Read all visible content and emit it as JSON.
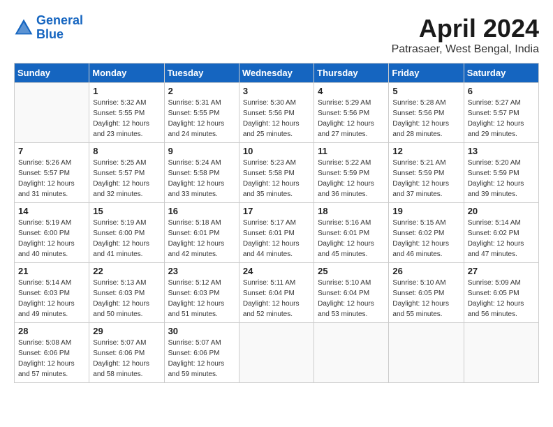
{
  "logo": {
    "line1": "General",
    "line2": "Blue"
  },
  "title": "April 2024",
  "subtitle": "Patrasaer, West Bengal, India",
  "headers": [
    "Sunday",
    "Monday",
    "Tuesday",
    "Wednesday",
    "Thursday",
    "Friday",
    "Saturday"
  ],
  "weeks": [
    [
      {
        "day": "",
        "sunrise": "",
        "sunset": "",
        "daylight": ""
      },
      {
        "day": "1",
        "sunrise": "Sunrise: 5:32 AM",
        "sunset": "Sunset: 5:55 PM",
        "daylight": "Daylight: 12 hours and 23 minutes."
      },
      {
        "day": "2",
        "sunrise": "Sunrise: 5:31 AM",
        "sunset": "Sunset: 5:55 PM",
        "daylight": "Daylight: 12 hours and 24 minutes."
      },
      {
        "day": "3",
        "sunrise": "Sunrise: 5:30 AM",
        "sunset": "Sunset: 5:56 PM",
        "daylight": "Daylight: 12 hours and 25 minutes."
      },
      {
        "day": "4",
        "sunrise": "Sunrise: 5:29 AM",
        "sunset": "Sunset: 5:56 PM",
        "daylight": "Daylight: 12 hours and 27 minutes."
      },
      {
        "day": "5",
        "sunrise": "Sunrise: 5:28 AM",
        "sunset": "Sunset: 5:56 PM",
        "daylight": "Daylight: 12 hours and 28 minutes."
      },
      {
        "day": "6",
        "sunrise": "Sunrise: 5:27 AM",
        "sunset": "Sunset: 5:57 PM",
        "daylight": "Daylight: 12 hours and 29 minutes."
      }
    ],
    [
      {
        "day": "7",
        "sunrise": "Sunrise: 5:26 AM",
        "sunset": "Sunset: 5:57 PM",
        "daylight": "Daylight: 12 hours and 31 minutes."
      },
      {
        "day": "8",
        "sunrise": "Sunrise: 5:25 AM",
        "sunset": "Sunset: 5:57 PM",
        "daylight": "Daylight: 12 hours and 32 minutes."
      },
      {
        "day": "9",
        "sunrise": "Sunrise: 5:24 AM",
        "sunset": "Sunset: 5:58 PM",
        "daylight": "Daylight: 12 hours and 33 minutes."
      },
      {
        "day": "10",
        "sunrise": "Sunrise: 5:23 AM",
        "sunset": "Sunset: 5:58 PM",
        "daylight": "Daylight: 12 hours and 35 minutes."
      },
      {
        "day": "11",
        "sunrise": "Sunrise: 5:22 AM",
        "sunset": "Sunset: 5:59 PM",
        "daylight": "Daylight: 12 hours and 36 minutes."
      },
      {
        "day": "12",
        "sunrise": "Sunrise: 5:21 AM",
        "sunset": "Sunset: 5:59 PM",
        "daylight": "Daylight: 12 hours and 37 minutes."
      },
      {
        "day": "13",
        "sunrise": "Sunrise: 5:20 AM",
        "sunset": "Sunset: 5:59 PM",
        "daylight": "Daylight: 12 hours and 39 minutes."
      }
    ],
    [
      {
        "day": "14",
        "sunrise": "Sunrise: 5:19 AM",
        "sunset": "Sunset: 6:00 PM",
        "daylight": "Daylight: 12 hours and 40 minutes."
      },
      {
        "day": "15",
        "sunrise": "Sunrise: 5:19 AM",
        "sunset": "Sunset: 6:00 PM",
        "daylight": "Daylight: 12 hours and 41 minutes."
      },
      {
        "day": "16",
        "sunrise": "Sunrise: 5:18 AM",
        "sunset": "Sunset: 6:01 PM",
        "daylight": "Daylight: 12 hours and 42 minutes."
      },
      {
        "day": "17",
        "sunrise": "Sunrise: 5:17 AM",
        "sunset": "Sunset: 6:01 PM",
        "daylight": "Daylight: 12 hours and 44 minutes."
      },
      {
        "day": "18",
        "sunrise": "Sunrise: 5:16 AM",
        "sunset": "Sunset: 6:01 PM",
        "daylight": "Daylight: 12 hours and 45 minutes."
      },
      {
        "day": "19",
        "sunrise": "Sunrise: 5:15 AM",
        "sunset": "Sunset: 6:02 PM",
        "daylight": "Daylight: 12 hours and 46 minutes."
      },
      {
        "day": "20",
        "sunrise": "Sunrise: 5:14 AM",
        "sunset": "Sunset: 6:02 PM",
        "daylight": "Daylight: 12 hours and 47 minutes."
      }
    ],
    [
      {
        "day": "21",
        "sunrise": "Sunrise: 5:14 AM",
        "sunset": "Sunset: 6:03 PM",
        "daylight": "Daylight: 12 hours and 49 minutes."
      },
      {
        "day": "22",
        "sunrise": "Sunrise: 5:13 AM",
        "sunset": "Sunset: 6:03 PM",
        "daylight": "Daylight: 12 hours and 50 minutes."
      },
      {
        "day": "23",
        "sunrise": "Sunrise: 5:12 AM",
        "sunset": "Sunset: 6:03 PM",
        "daylight": "Daylight: 12 hours and 51 minutes."
      },
      {
        "day": "24",
        "sunrise": "Sunrise: 5:11 AM",
        "sunset": "Sunset: 6:04 PM",
        "daylight": "Daylight: 12 hours and 52 minutes."
      },
      {
        "day": "25",
        "sunrise": "Sunrise: 5:10 AM",
        "sunset": "Sunset: 6:04 PM",
        "daylight": "Daylight: 12 hours and 53 minutes."
      },
      {
        "day": "26",
        "sunrise": "Sunrise: 5:10 AM",
        "sunset": "Sunset: 6:05 PM",
        "daylight": "Daylight: 12 hours and 55 minutes."
      },
      {
        "day": "27",
        "sunrise": "Sunrise: 5:09 AM",
        "sunset": "Sunset: 6:05 PM",
        "daylight": "Daylight: 12 hours and 56 minutes."
      }
    ],
    [
      {
        "day": "28",
        "sunrise": "Sunrise: 5:08 AM",
        "sunset": "Sunset: 6:06 PM",
        "daylight": "Daylight: 12 hours and 57 minutes."
      },
      {
        "day": "29",
        "sunrise": "Sunrise: 5:07 AM",
        "sunset": "Sunset: 6:06 PM",
        "daylight": "Daylight: 12 hours and 58 minutes."
      },
      {
        "day": "30",
        "sunrise": "Sunrise: 5:07 AM",
        "sunset": "Sunset: 6:06 PM",
        "daylight": "Daylight: 12 hours and 59 minutes."
      },
      {
        "day": "",
        "sunrise": "",
        "sunset": "",
        "daylight": ""
      },
      {
        "day": "",
        "sunrise": "",
        "sunset": "",
        "daylight": ""
      },
      {
        "day": "",
        "sunrise": "",
        "sunset": "",
        "daylight": ""
      },
      {
        "day": "",
        "sunrise": "",
        "sunset": "",
        "daylight": ""
      }
    ]
  ]
}
